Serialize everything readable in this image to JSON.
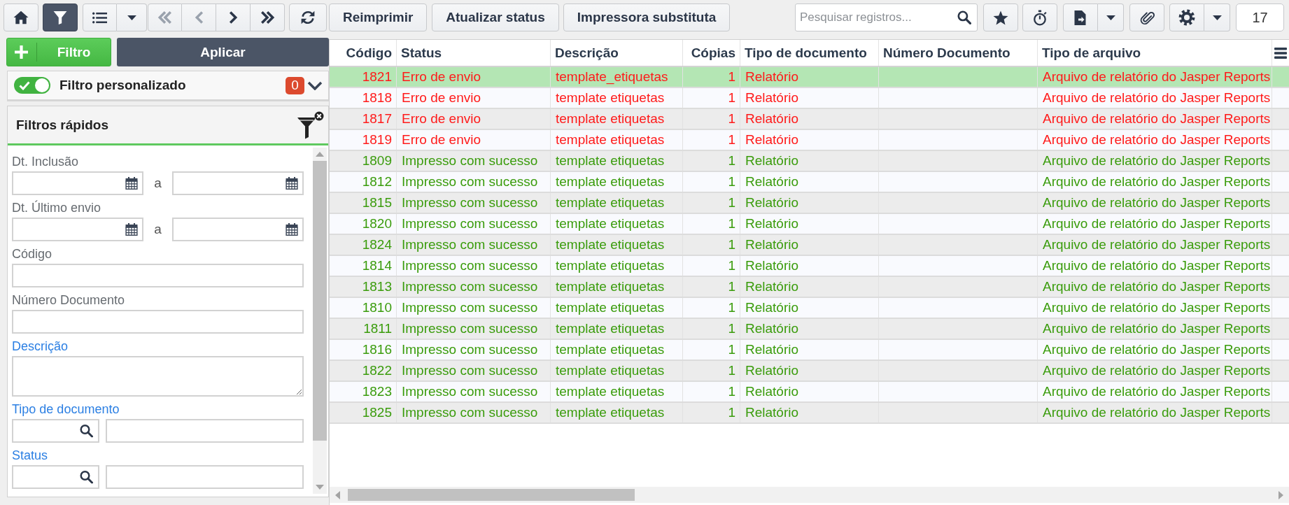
{
  "toolbar": {
    "filter_active": true,
    "navigation": [
      {
        "kind": "first",
        "disabled": true
      },
      {
        "kind": "previous",
        "disabled": true
      },
      {
        "kind": "next",
        "disabled": false
      },
      {
        "kind": "last",
        "disabled": false
      }
    ],
    "actions": [
      "Reimprimir",
      "Atualizar status",
      "Impressora substituta"
    ],
    "search": {
      "placeholder": "Pesquisar registros..."
    },
    "record_count": "17"
  },
  "filter_panel": {
    "new_filter_button": "Filtro",
    "apply_button": "Aplicar",
    "custom_filter": {
      "label": "Filtro personalizado",
      "on": true,
      "count": "0"
    },
    "quick_filters": {
      "title": "Filtros rápidos",
      "fields": [
        {
          "kind": "date_range",
          "label": "Dt. Inclusão",
          "highlighted": false,
          "separator": "a"
        },
        {
          "kind": "date_range",
          "label": "Dt. Último envio",
          "highlighted": false,
          "separator": "a"
        },
        {
          "kind": "text",
          "label": "Código",
          "highlighted": false
        },
        {
          "kind": "text",
          "label": "Número Documento",
          "highlighted": false
        },
        {
          "kind": "textarea",
          "label": "Descrição",
          "highlighted": true
        },
        {
          "kind": "lookup",
          "label": "Tipo de documento",
          "highlighted": true
        },
        {
          "kind": "lookup",
          "label": "Status",
          "highlighted": true
        }
      ]
    }
  },
  "table": {
    "columns": [
      {
        "label": "Código",
        "kind": "number"
      },
      {
        "label": "Status",
        "kind": "text"
      },
      {
        "label": "Descrição",
        "kind": "text"
      },
      {
        "label": "Cópias",
        "kind": "number"
      },
      {
        "label": "Tipo de documento",
        "kind": "text"
      },
      {
        "label": "Número Documento",
        "kind": "text"
      },
      {
        "label": "Tipo de arquivo",
        "kind": "text"
      }
    ],
    "rows": [
      {
        "code": "1821",
        "status": "Erro de envio",
        "description": "template_etiquetas",
        "copies": "1",
        "document_type": "Relatório",
        "file_type": "Arquivo de relatório do Jasper Reports",
        "color": "#ff1a1a",
        "selected": true
      },
      {
        "code": "1818",
        "status": "Erro de envio",
        "description": "template etiquetas",
        "copies": "1",
        "document_type": "Relatório",
        "file_type": "Arquivo de relatório do Jasper Reports",
        "color": "#ff1a1a",
        "selected": false
      },
      {
        "code": "1817",
        "status": "Erro de envio",
        "description": "template etiquetas",
        "copies": "1",
        "document_type": "Relatório",
        "file_type": "Arquivo de relatório do Jasper Reports",
        "color": "#ff1a1a",
        "selected": false
      },
      {
        "code": "1819",
        "status": "Erro de envio",
        "description": "template etiquetas",
        "copies": "1",
        "document_type": "Relatório",
        "file_type": "Arquivo de relatório do Jasper Reports",
        "color": "#ff1a1a",
        "selected": false
      },
      {
        "code": "1809",
        "status": "Impresso com sucesso",
        "description": "template etiquetas",
        "copies": "1",
        "document_type": "Relatório",
        "file_type": "Arquivo de relatório do Jasper Reports",
        "color": "#3a9c0c",
        "selected": false
      },
      {
        "code": "1812",
        "status": "Impresso com sucesso",
        "description": "template etiquetas",
        "copies": "1",
        "document_type": "Relatório",
        "file_type": "Arquivo de relatório do Jasper Reports",
        "color": "#3a9c0c",
        "selected": false
      },
      {
        "code": "1815",
        "status": "Impresso com sucesso",
        "description": "template etiquetas",
        "copies": "1",
        "document_type": "Relatório",
        "file_type": "Arquivo de relatório do Jasper Reports",
        "color": "#3a9c0c",
        "selected": false
      },
      {
        "code": "1820",
        "status": "Impresso com sucesso",
        "description": "template etiquetas",
        "copies": "1",
        "document_type": "Relatório",
        "file_type": "Arquivo de relatório do Jasper Reports",
        "color": "#3a9c0c",
        "selected": false
      },
      {
        "code": "1824",
        "status": "Impresso com sucesso",
        "description": "template etiquetas",
        "copies": "1",
        "document_type": "Relatório",
        "file_type": "Arquivo de relatório do Jasper Reports",
        "color": "#3a9c0c",
        "selected": false
      },
      {
        "code": "1814",
        "status": "Impresso com sucesso",
        "description": "template etiquetas",
        "copies": "1",
        "document_type": "Relatório",
        "file_type": "Arquivo de relatório do Jasper Reports",
        "color": "#3a9c0c",
        "selected": false
      },
      {
        "code": "1813",
        "status": "Impresso com sucesso",
        "description": "template etiquetas",
        "copies": "1",
        "document_type": "Relatório",
        "file_type": "Arquivo de relatório do Jasper Reports",
        "color": "#3a9c0c",
        "selected": false
      },
      {
        "code": "1810",
        "status": "Impresso com sucesso",
        "description": "template etiquetas",
        "copies": "1",
        "document_type": "Relatório",
        "file_type": "Arquivo de relatório do Jasper Reports",
        "color": "#3a9c0c",
        "selected": false
      },
      {
        "code": "1811",
        "status": "Impresso com sucesso",
        "description": "template etiquetas",
        "copies": "1",
        "document_type": "Relatório",
        "file_type": "Arquivo de relatório do Jasper Reports",
        "color": "#3a9c0c",
        "selected": false
      },
      {
        "code": "1816",
        "status": "Impresso com sucesso",
        "description": "template etiquetas",
        "copies": "1",
        "document_type": "Relatório",
        "file_type": "Arquivo de relatório do Jasper Reports",
        "color": "#3a9c0c",
        "selected": false
      },
      {
        "code": "1822",
        "status": "Impresso com sucesso",
        "description": "template etiquetas",
        "copies": "1",
        "document_type": "Relatório",
        "file_type": "Arquivo de relatório do Jasper Reports",
        "color": "#3a9c0c",
        "selected": false
      },
      {
        "code": "1823",
        "status": "Impresso com sucesso",
        "description": "template etiquetas",
        "copies": "1",
        "document_type": "Relatório",
        "file_type": "Arquivo de relatório do Jasper Reports",
        "color": "#3a9c0c",
        "selected": false
      },
      {
        "code": "1825",
        "status": "Impresso com sucesso",
        "description": "template etiquetas",
        "copies": "1",
        "document_type": "Relatório",
        "file_type": "Arquivo de relatório do Jasper Reports",
        "color": "#3a9c0c",
        "selected": false
      }
    ]
  }
}
